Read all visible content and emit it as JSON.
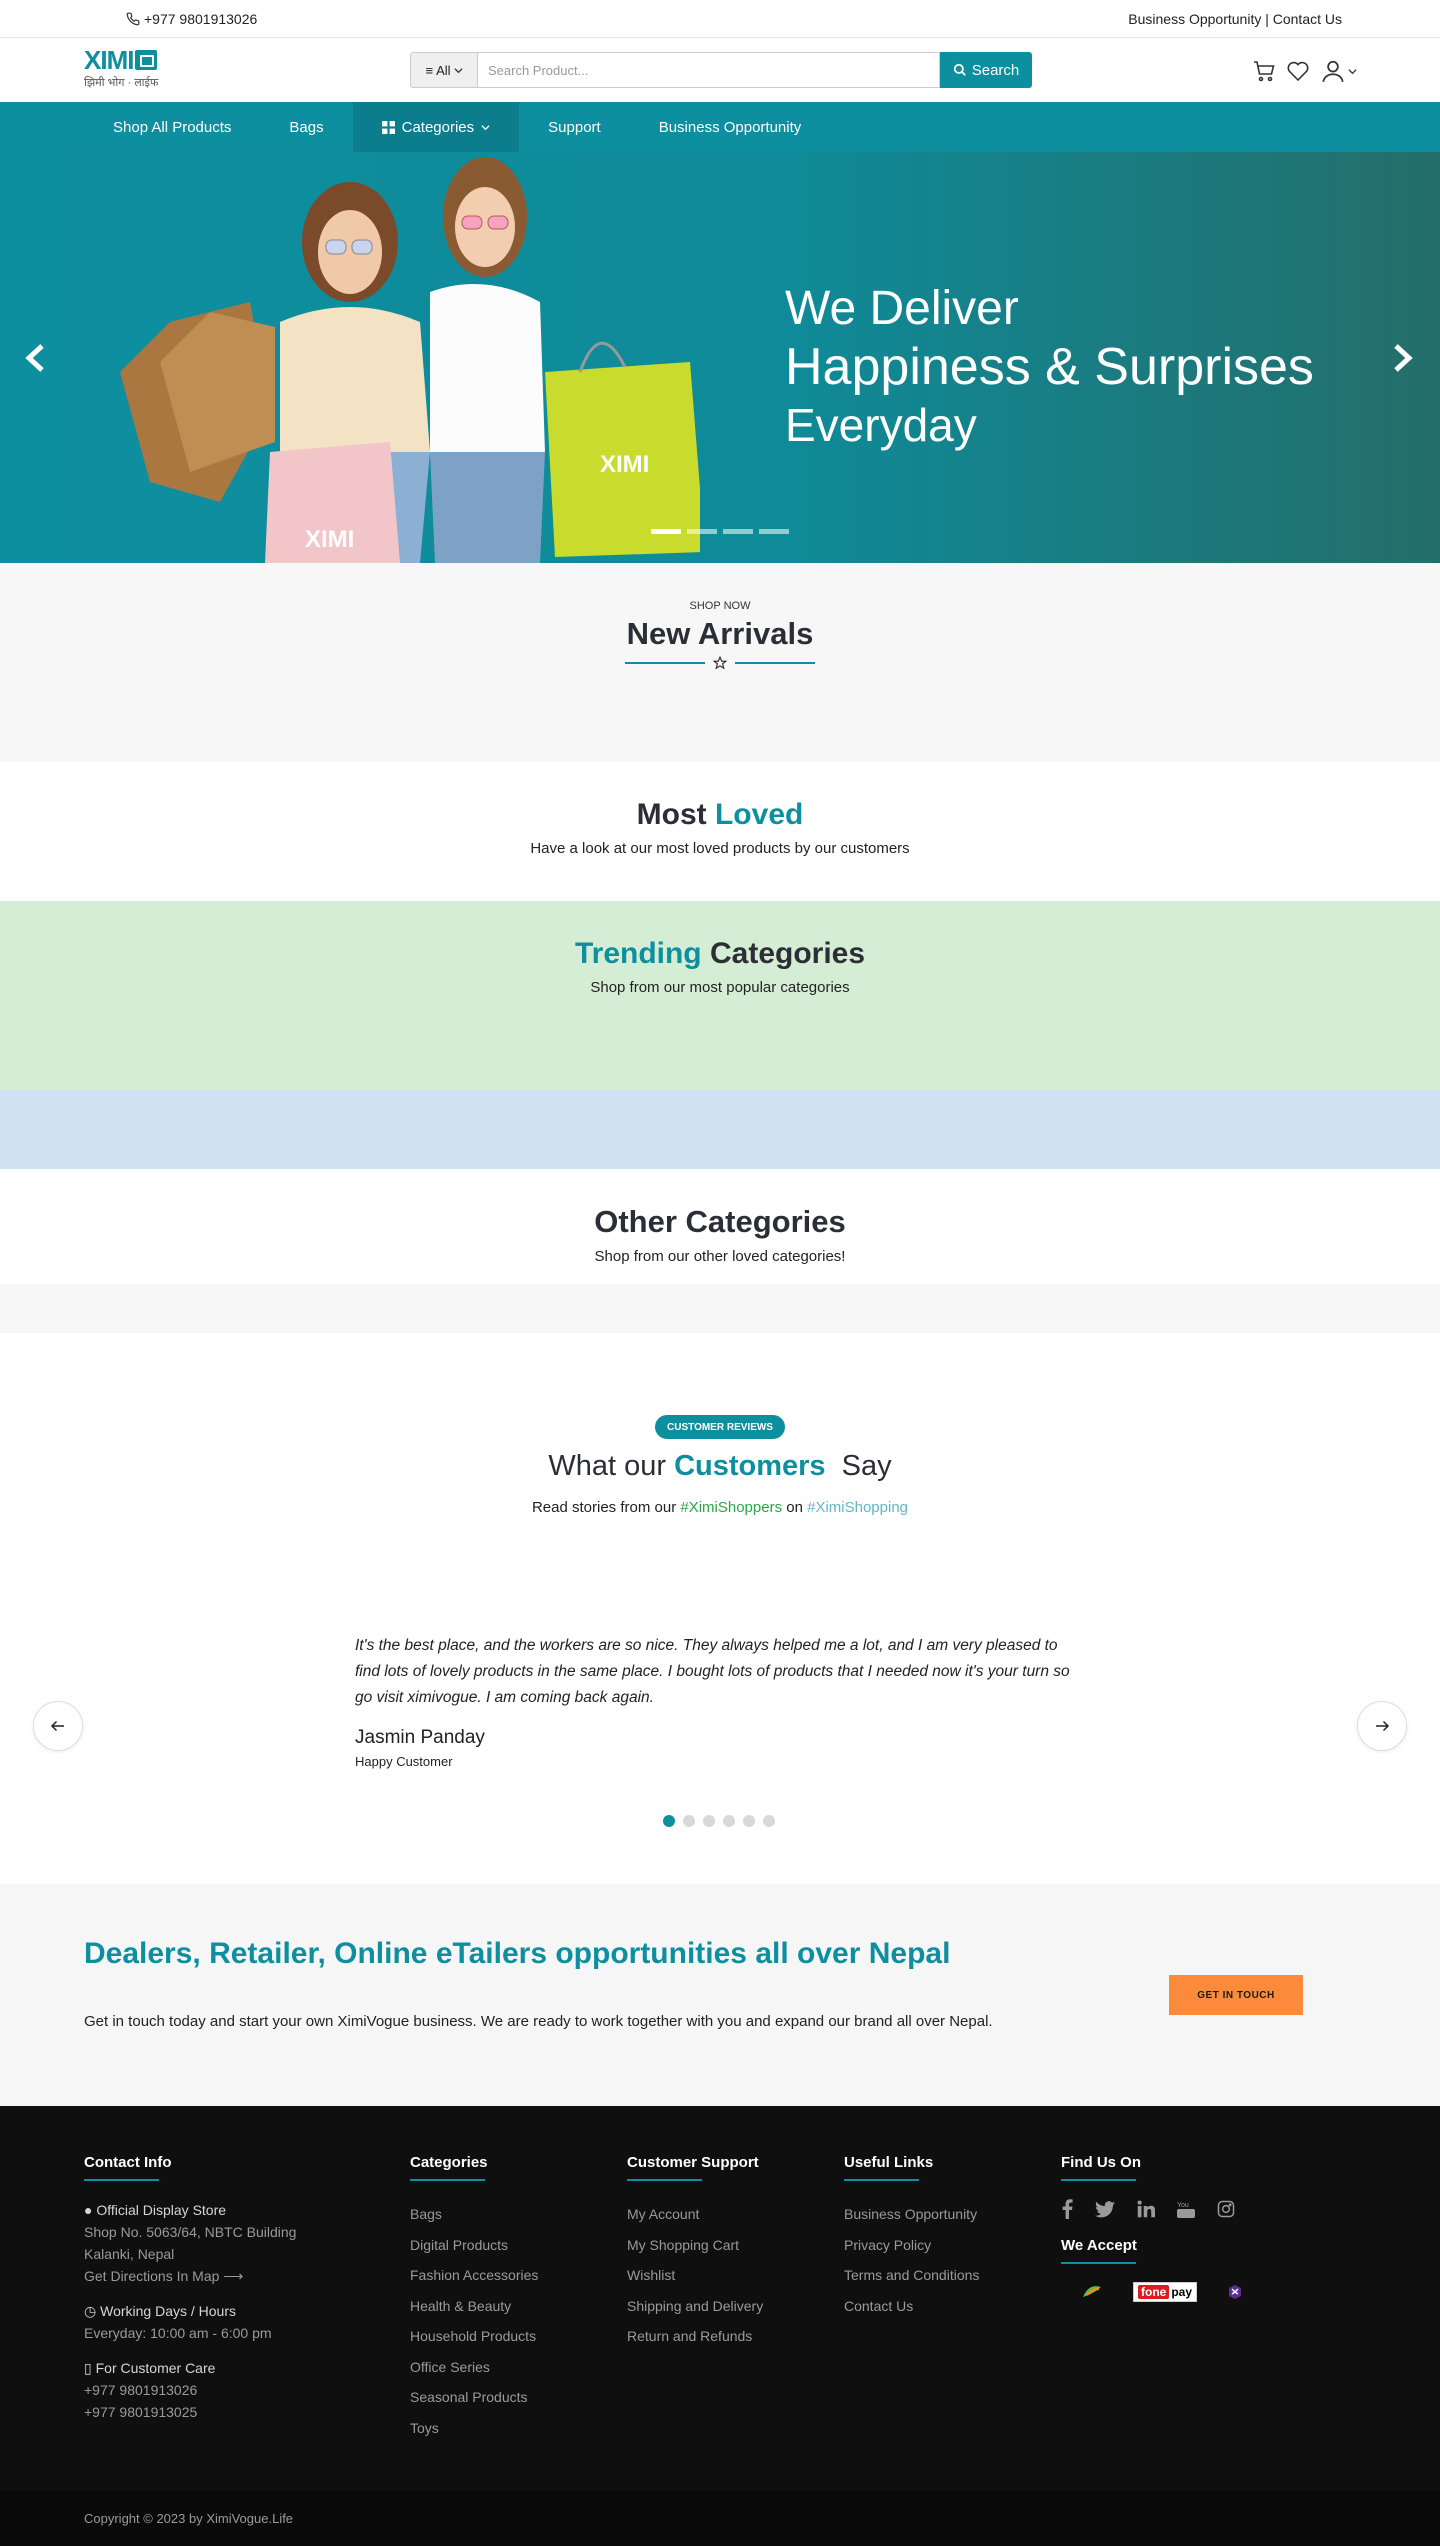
{
  "topbar": {
    "phone": "+977 9801913026",
    "links": "Business Opportunity | Contact Us"
  },
  "header": {
    "logo_text": "XIMI",
    "logo_tagline": "झिमी भोग · लाईफ",
    "category_select": "All",
    "search_placeholder": "Search Product...",
    "search_button": "Search"
  },
  "nav": [
    {
      "label": "Shop All Products"
    },
    {
      "label": "Bags"
    },
    {
      "label": "Categories"
    },
    {
      "label": "Support"
    },
    {
      "label": "Business Opportunity"
    }
  ],
  "hero": {
    "line1": "We Deliver",
    "line2": "Happiness & Surprises",
    "line3": "Everyday",
    "bag_logo": "XIMI",
    "slides": 4,
    "active_slide": 1
  },
  "new_arrivals": {
    "kicker": "SHOP NOW",
    "title": "New Arrivals"
  },
  "most_loved": {
    "title_a": "Most ",
    "title_b": "Loved",
    "subtitle": "Have a look at our most loved products by our customers"
  },
  "trending": {
    "title_a": "Trending",
    "title_b": " Categories",
    "subtitle": "Shop from our most popular categories"
  },
  "other": {
    "title": "Other Categories",
    "subtitle": "Shop from our other loved categories!"
  },
  "reviews": {
    "badge": "CUSTOMER REVIEWS",
    "title_a": "What our ",
    "title_b": "Customers",
    "title_c": "  Say",
    "sub_a": "Read stories from our ",
    "tag1": "#XimiShoppers",
    "sub_b": " on ",
    "tag2": "#XimiShopping",
    "quote": "It's the best place, and the workers are so nice. They always helped me a lot, and I am very pleased to find lots of lovely products in the same place. I bought lots of products that I needed now it's your turn so go visit ximivogue. I am coming back again.",
    "name": "Jasmin Panday",
    "role": "Happy Customer",
    "dots": 6,
    "active_dot": 1
  },
  "dealers": {
    "title": "Dealers, Retailer, Online eTailers opportunities all over Nepal",
    "text": "Get in touch today and start your own XimiVogue business. We are ready to work together with you and expand our brand all over Nepal.",
    "button": "GET IN TOUCH"
  },
  "footer": {
    "contact": {
      "title": "Contact Info",
      "store_label": "Official Display Store",
      "address1": "Shop No. 5063/64, NBTC Building",
      "address2": "Kalanki, Nepal",
      "directions": "Get Directions In Map ⟶",
      "hours_label": "Working Days / Hours",
      "hours": "Everyday: 10:00 am - 6:00 pm",
      "care_label": "For Customer Care",
      "phone1": "+977 9801913026",
      "phone2": "+977 9801913025"
    },
    "categories": {
      "title": "Categories",
      "items": [
        "Bags",
        "Digital Products",
        "Fashion Accessories",
        "Health & Beauty",
        "Household Products",
        "Office Series",
        "Seasonal Products",
        "Toys"
      ]
    },
    "support": {
      "title": "Customer Support",
      "items": [
        "My Account",
        "My Shopping Cart",
        "Wishlist",
        "Shipping and Delivery",
        "Return and Refunds"
      ]
    },
    "useful": {
      "title": "Useful Links",
      "items": [
        "Business Opportunity",
        "Privacy Policy",
        "Terms and Conditions",
        "Contact Us"
      ]
    },
    "find": {
      "title": "Find Us On",
      "accept_title": "We Accept",
      "fonepay_a": "fone",
      "fonepay_b": "pay"
    },
    "copyright": "Copyright © 2023 by XimiVogue.Life"
  },
  "colors": {
    "brand": "#0e8fa0",
    "cta": "#fb8b3a",
    "trend_bg": "#d5edd5",
    "blue_band": "#cfe3f3",
    "footer_bg": "#0f0f10"
  }
}
